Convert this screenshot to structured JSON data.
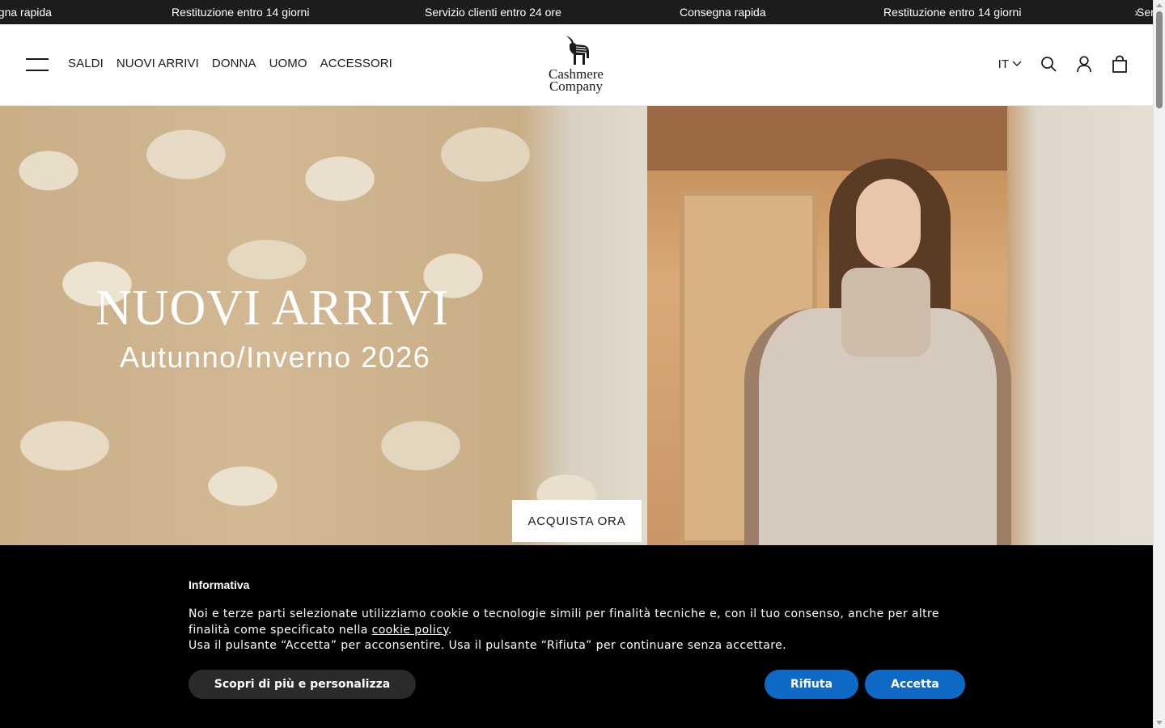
{
  "announcement": {
    "items": [
      "egna rapida",
      "Restituzione entro 14 giorni",
      "Servizio clienti entro 24 ore",
      "Consegna rapida",
      "Restituzione entro 14 giorni",
      "Ser"
    ],
    "arrow": "›"
  },
  "header": {
    "nav": [
      "SALDI",
      "NUOVI ARRIVI",
      "DONNA",
      "UOMO",
      "ACCESSORI"
    ],
    "logo_line1": "Cashmere",
    "logo_line2": "Company",
    "language": "IT",
    "icons": [
      "menu-icon",
      "search-icon",
      "account-icon",
      "bag-icon"
    ]
  },
  "hero": {
    "title": "NUOVI ARRIVI",
    "subtitle": "Autunno/Inverno 2026",
    "cta": "ACQUISTA ORA"
  },
  "cookie": {
    "title": "Informativa",
    "text_part1": "Noi e terze parti selezionate utilizziamo cookie o tecnologie simili per finalità tecniche e, con il tuo consenso, anche per altre finalità come specificato nella ",
    "link": "cookie policy",
    "text_part2": ".",
    "text_line2": "Usa il pulsante “Accetta” per acconsentire. Usa il pulsante “Rifiuta” per continuare senza accettare.",
    "btn_more": "Scopri di più e personalizza",
    "btn_reject": "Rifiuta",
    "btn_accept": "Accetta"
  },
  "colors": {
    "announcement_bg": "#1c1c1c",
    "cookie_bg": "#000000",
    "button_blue": "#0f6ac6",
    "button_dark": "#2a2a2a"
  }
}
